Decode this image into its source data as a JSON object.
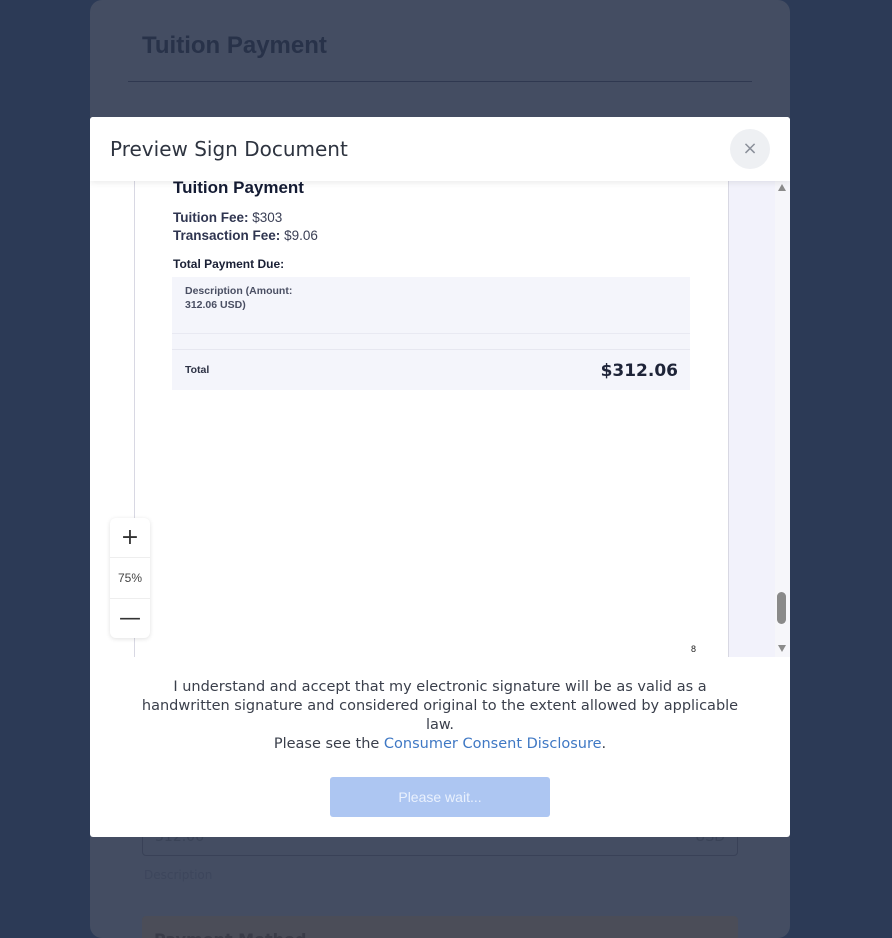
{
  "background": {
    "title": "Tuition Payment",
    "amount_value": "312.06",
    "currency": "USD",
    "amount_help": "Description",
    "payment_method_label": "Payment Method"
  },
  "modal": {
    "title": "Preview Sign Document",
    "close_icon": "×"
  },
  "document": {
    "title": "Tuition Payment",
    "tuition_fee_label": "Tuition Fee:",
    "tuition_fee_value": "$303",
    "transaction_fee_label": "Transaction Fee:",
    "transaction_fee_value": "$9.06",
    "total_due_label": "Total Payment Due:",
    "description_text": "Description (Amount: 312.06 USD)",
    "total_label": "Total",
    "total_value": "$312.06",
    "page_number": "8"
  },
  "zoom": {
    "in_symbol": "+",
    "level": "75%",
    "out_symbol": "—"
  },
  "consent": {
    "text": "I understand and accept that my electronic signature will be as valid as a handwritten signature and considered original to the extent allowed by applicable law.",
    "disclosure_prefix": "Please see the ",
    "disclosure_link": "Consumer Consent Disclosure",
    "disclosure_suffix": ".",
    "button_label": "Please wait..."
  },
  "colors": {
    "page_bg": "#2c3a56",
    "link": "#3f78c4",
    "button_disabled": "#adc6f2"
  },
  "scroll": {
    "position_fraction": 0.96
  }
}
